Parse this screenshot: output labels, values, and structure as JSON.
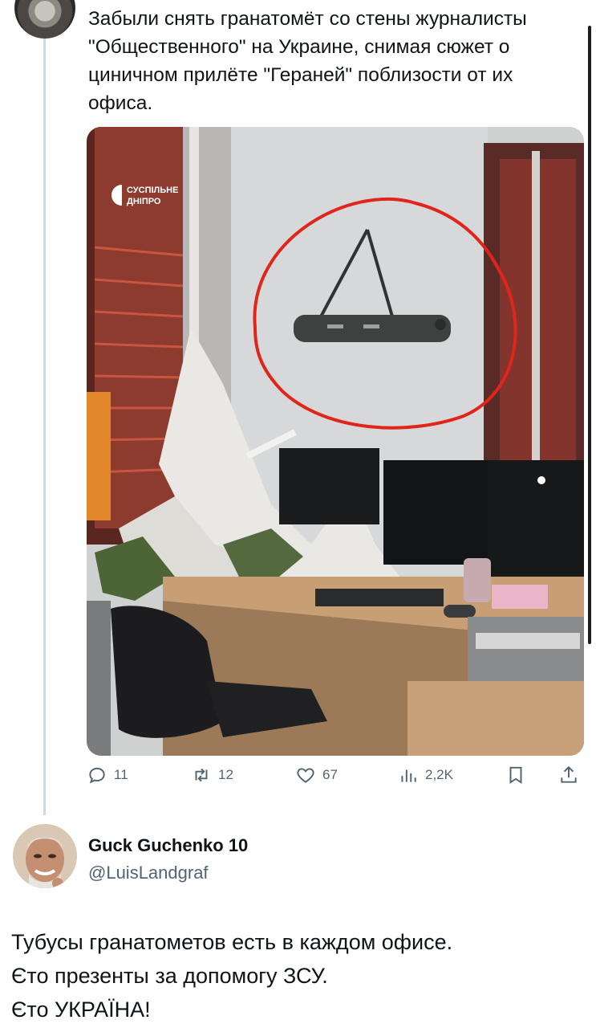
{
  "tweet": {
    "lines": [
      "Забыли снять гранатомёт со стены журналисты",
      "\"Общественного\" на Украине, снимая сюжет о",
      "циничном прилёте \"Гераней\" поблизости от их",
      "офиса."
    ],
    "media": {
      "watermark_line1": "СУСПІЛЬНЕ",
      "watermark_line2": "ДНІПРО"
    },
    "actions": {
      "replies": "11",
      "retweets": "12",
      "likes": "67",
      "views": "2,2K"
    }
  },
  "reply": {
    "display_name": "Guck Guchenko 10",
    "handle": "@LuisLandgraf",
    "lines": [
      "Тубусы гранатометов есть в каждом офисе.",
      "Єто презенты за допомогу ЗСУ.",
      "Єто УКРАЇНА!"
    ]
  },
  "colors": {
    "annotation_circle": "#e0251b",
    "secondary_text": "#536471",
    "thread_line": "#cfd9de"
  }
}
